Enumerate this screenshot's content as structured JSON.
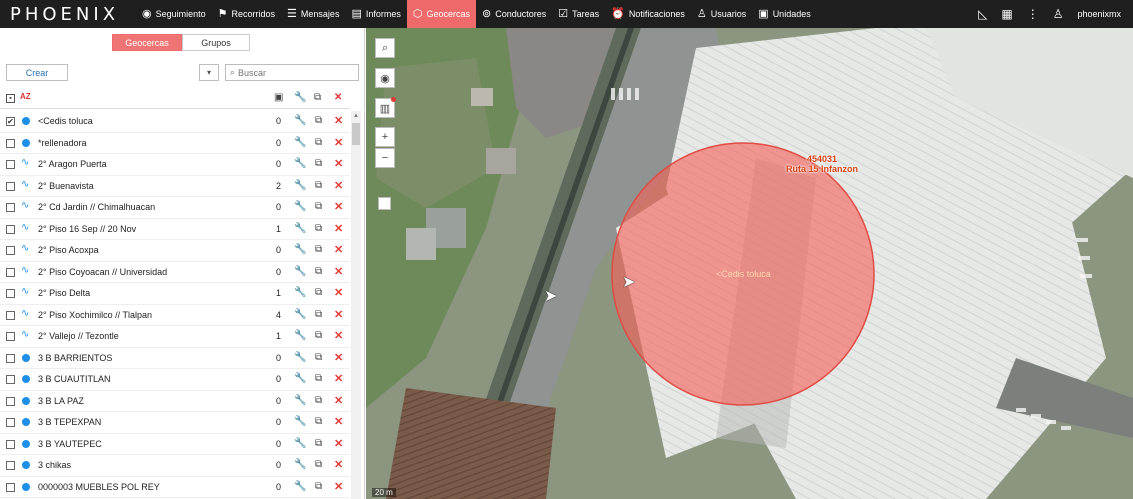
{
  "app": {
    "brand": "PHOENIX"
  },
  "nav": {
    "items": [
      {
        "label": "Seguimiento",
        "icon": "globe-icon"
      },
      {
        "label": "Recorridos",
        "icon": "flag-icon"
      },
      {
        "label": "Mensajes",
        "icon": "message-icon"
      },
      {
        "label": "Informes",
        "icon": "chart-icon"
      },
      {
        "label": "Geocercas",
        "icon": "geofence-icon",
        "active": true
      },
      {
        "label": "Conductores",
        "icon": "steering-wheel-icon"
      },
      {
        "label": "Tareas",
        "icon": "task-check-icon"
      },
      {
        "label": "Notificaciones",
        "icon": "alarm-icon"
      },
      {
        "label": "Usuarios",
        "icon": "user-icon"
      },
      {
        "label": "Unidades",
        "icon": "bus-icon"
      }
    ],
    "user": "phoenixmx"
  },
  "panel": {
    "tabs": {
      "geocercas": "Geocercas",
      "grupos": "Grupos"
    },
    "create_label": "Crear",
    "search_placeholder": "Buscar",
    "sort_label": "AZ",
    "rows": [
      {
        "type": "dot",
        "name": "<Cedis toluca",
        "count": "0",
        "checked": true
      },
      {
        "type": "dot",
        "name": "*rellenadora",
        "count": "0"
      },
      {
        "type": "route",
        "name": "2° Aragon Puerta",
        "count": "0"
      },
      {
        "type": "route",
        "name": "2° Buenavista",
        "count": "2"
      },
      {
        "type": "route",
        "name": "2° Cd Jardin // Chimalhuacan",
        "count": "0"
      },
      {
        "type": "route",
        "name": "2° Piso 16 Sep // 20 Nov",
        "count": "1"
      },
      {
        "type": "route",
        "name": "2° Piso Acoxpa",
        "count": "0"
      },
      {
        "type": "route",
        "name": "2° Piso Coyoacan // Universidad",
        "count": "0"
      },
      {
        "type": "route",
        "name": "2° Piso Delta",
        "count": "1"
      },
      {
        "type": "route",
        "name": "2° Piso Xochimilco // Tlalpan",
        "count": "4"
      },
      {
        "type": "route",
        "name": "2° Vallejo // Tezontle",
        "count": "1"
      },
      {
        "type": "dot",
        "name": "3 B BARRIENTOS",
        "count": "0"
      },
      {
        "type": "dot",
        "name": "3 B CUAUTITLAN",
        "count": "0"
      },
      {
        "type": "dot",
        "name": "3 B LA PAZ",
        "count": "0"
      },
      {
        "type": "dot",
        "name": "3 B TEPEXPAN",
        "count": "0"
      },
      {
        "type": "dot",
        "name": "3 B YAUTEPEC",
        "count": "0"
      },
      {
        "type": "dot",
        "name": "3 chikas",
        "count": "0"
      },
      {
        "type": "dot",
        "name": "0000003 MUEBLES POL REY",
        "count": "0"
      }
    ]
  },
  "map": {
    "geofence_label": "<Cedis toluca",
    "vehicle_id": "454031",
    "vehicle_route": "Ruta 15 Infanzon",
    "scale": "20 m"
  },
  "colors": {
    "accent": "#ef6b6b",
    "dot_blue": "#1e8fe8",
    "delete_red": "#e53935",
    "geofence_fill": "#f5615a"
  }
}
